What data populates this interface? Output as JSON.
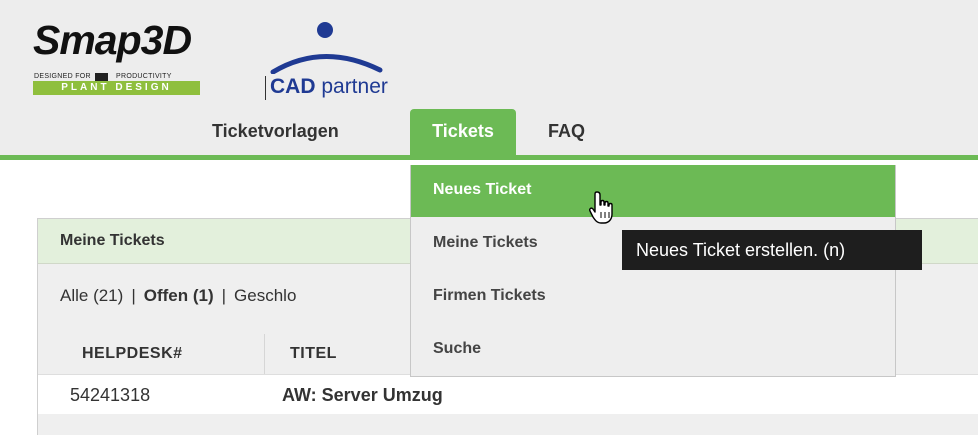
{
  "brand": {
    "smap_word": "Smap3D",
    "smap_tag_left": "DESIGNED FOR",
    "smap_tag_right": "PRODUCTIVITY",
    "smap_sub": "PLANT DESIGN",
    "cad_bold": "CAD",
    "cad_rest": " partner"
  },
  "nav": {
    "items": [
      {
        "label": "Ticketvorlagen"
      },
      {
        "label": "Tickets",
        "active": true
      },
      {
        "label": "FAQ"
      }
    ]
  },
  "dropdown": {
    "items": [
      {
        "label": "Neues Ticket",
        "active": true
      },
      {
        "label": "Meine Tickets"
      },
      {
        "label": "Firmen Tickets"
      },
      {
        "label": "Suche"
      }
    ]
  },
  "tooltip": {
    "text": "Neues Ticket erstellen. (n)"
  },
  "panel": {
    "title": "Meine Tickets",
    "filters": {
      "all": "Alle (21)",
      "sep": "|",
      "open": "Offen (1)",
      "closed": "Geschlo"
    },
    "columns": [
      "HELPDESK#",
      "TITEL"
    ],
    "rows": [
      {
        "helpdesk": "54241318",
        "title": "AW: Server Umzug"
      }
    ]
  },
  "colors": {
    "accent_green": "#6cba55",
    "header_bg": "#ededed",
    "panel_head_bg": "#e3f0dc",
    "cad_blue": "#1f3a93",
    "tooltip_bg": "#1e1e1e"
  },
  "icons": {
    "cursor": "hand-pointer-icon"
  }
}
